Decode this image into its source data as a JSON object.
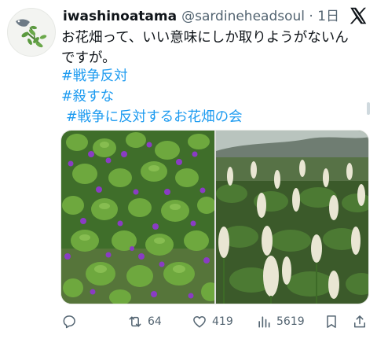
{
  "tweet": {
    "display_name": "iwashinoatama",
    "handle_time": "@sardineheadsoul · 1日",
    "text_line1": "お花畑って、いい意味にしか取りようがないん",
    "text_line2": "ですが。",
    "hashtags": [
      "#戦争反対",
      "#殺すな",
      "#戦争に反対するお花畑の会"
    ],
    "images": [
      {
        "icon": "photo-violets-leaves"
      },
      {
        "icon": "photo-white-flower-spikes"
      }
    ]
  },
  "actions": {
    "reply_icon": "reply-icon",
    "retweet_count": "64",
    "like_count": "419",
    "view_count": "5619",
    "bookmark_icon": "bookmark-icon",
    "share_icon": "share-icon"
  },
  "colors": {
    "link": "#1d9bf0",
    "secondary_text": "#536471"
  }
}
